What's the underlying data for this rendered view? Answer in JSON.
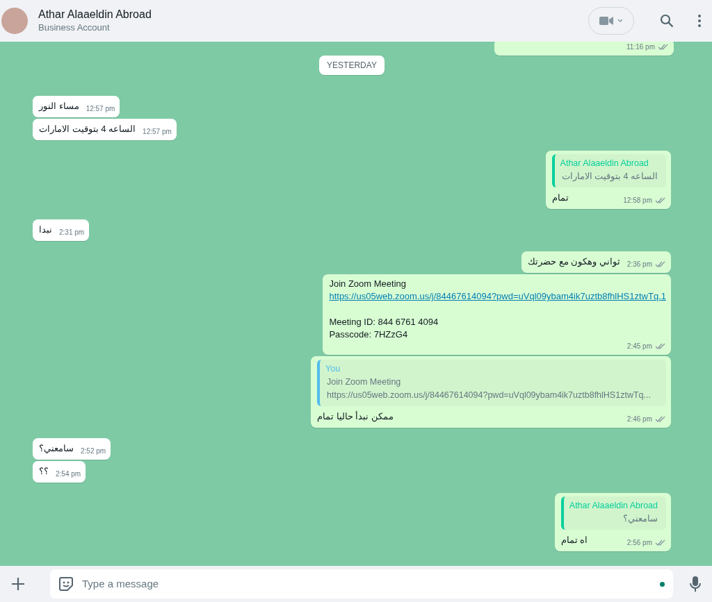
{
  "header": {
    "name": "Athar Alaaeldin Abroad",
    "subtitle": "Business Account"
  },
  "top_cut_message": {
    "time": "11:16 pm",
    "read": false
  },
  "date_chip": "YESTERDAY",
  "messages": [
    {
      "kind": "incoming",
      "text": "مساء النور",
      "time": "12:57 pm"
    },
    {
      "kind": "incoming",
      "text": "الساعه 4 بتوقيت الامارات",
      "time": "12:57 pm"
    },
    {
      "kind": "outgoing",
      "quote": {
        "author": "Athar Alaaeldin Abroad",
        "color": "#06cf9c",
        "lines": [
          "الساعه 4 بتوقيت الامارات"
        ]
      },
      "text": "تمام",
      "time": "12:58 pm",
      "read": false
    },
    {
      "kind": "incoming",
      "text": "نبدا",
      "time": "2:31 pm"
    },
    {
      "kind": "outgoing",
      "text": "ثواني وهكون مع حضرتك",
      "time": "2:36 pm",
      "read": false
    },
    {
      "kind": "outgoing",
      "paragraphs": [
        [
          {
            "kind": "text",
            "text": "Join Zoom Meeting"
          },
          {
            "kind": "link",
            "text": "https://us05web.zoom.us/j/84467614094?pwd=uVql09ybam4ik7uztb8fhlHS1ztwTq.1"
          }
        ],
        [
          {
            "kind": "text",
            "text": "Meeting ID: 844 6761 4094"
          },
          {
            "kind": "text",
            "text": "Passcode: 7HZzG4"
          }
        ]
      ],
      "time": "2:45 pm",
      "read": false
    },
    {
      "kind": "outgoing",
      "quote": {
        "author": "You",
        "color": "#53bdeb",
        "lines": [
          "Join Zoom Meeting",
          "https://us05web.zoom.us/j/84467614094?pwd=uVql09ybam4ik7uztb8fhlHS1ztwTq..."
        ]
      },
      "text": "ممكن نبدأ حاليا تمام",
      "time": "2:46 pm",
      "read": false
    },
    {
      "kind": "incoming",
      "text": "سامعني؟",
      "time": "2:52 pm"
    },
    {
      "kind": "incoming",
      "text": "؟؟",
      "time": "2:54 pm"
    },
    {
      "kind": "outgoing",
      "quote": {
        "author": "Athar Alaaeldin Abroad",
        "color": "#06cf9c",
        "lines": [
          "سامعني؟"
        ]
      },
      "text": "اه تمام",
      "time": "2:56 pm",
      "read": false
    }
  ],
  "composer": {
    "placeholder": "Type a message"
  }
}
